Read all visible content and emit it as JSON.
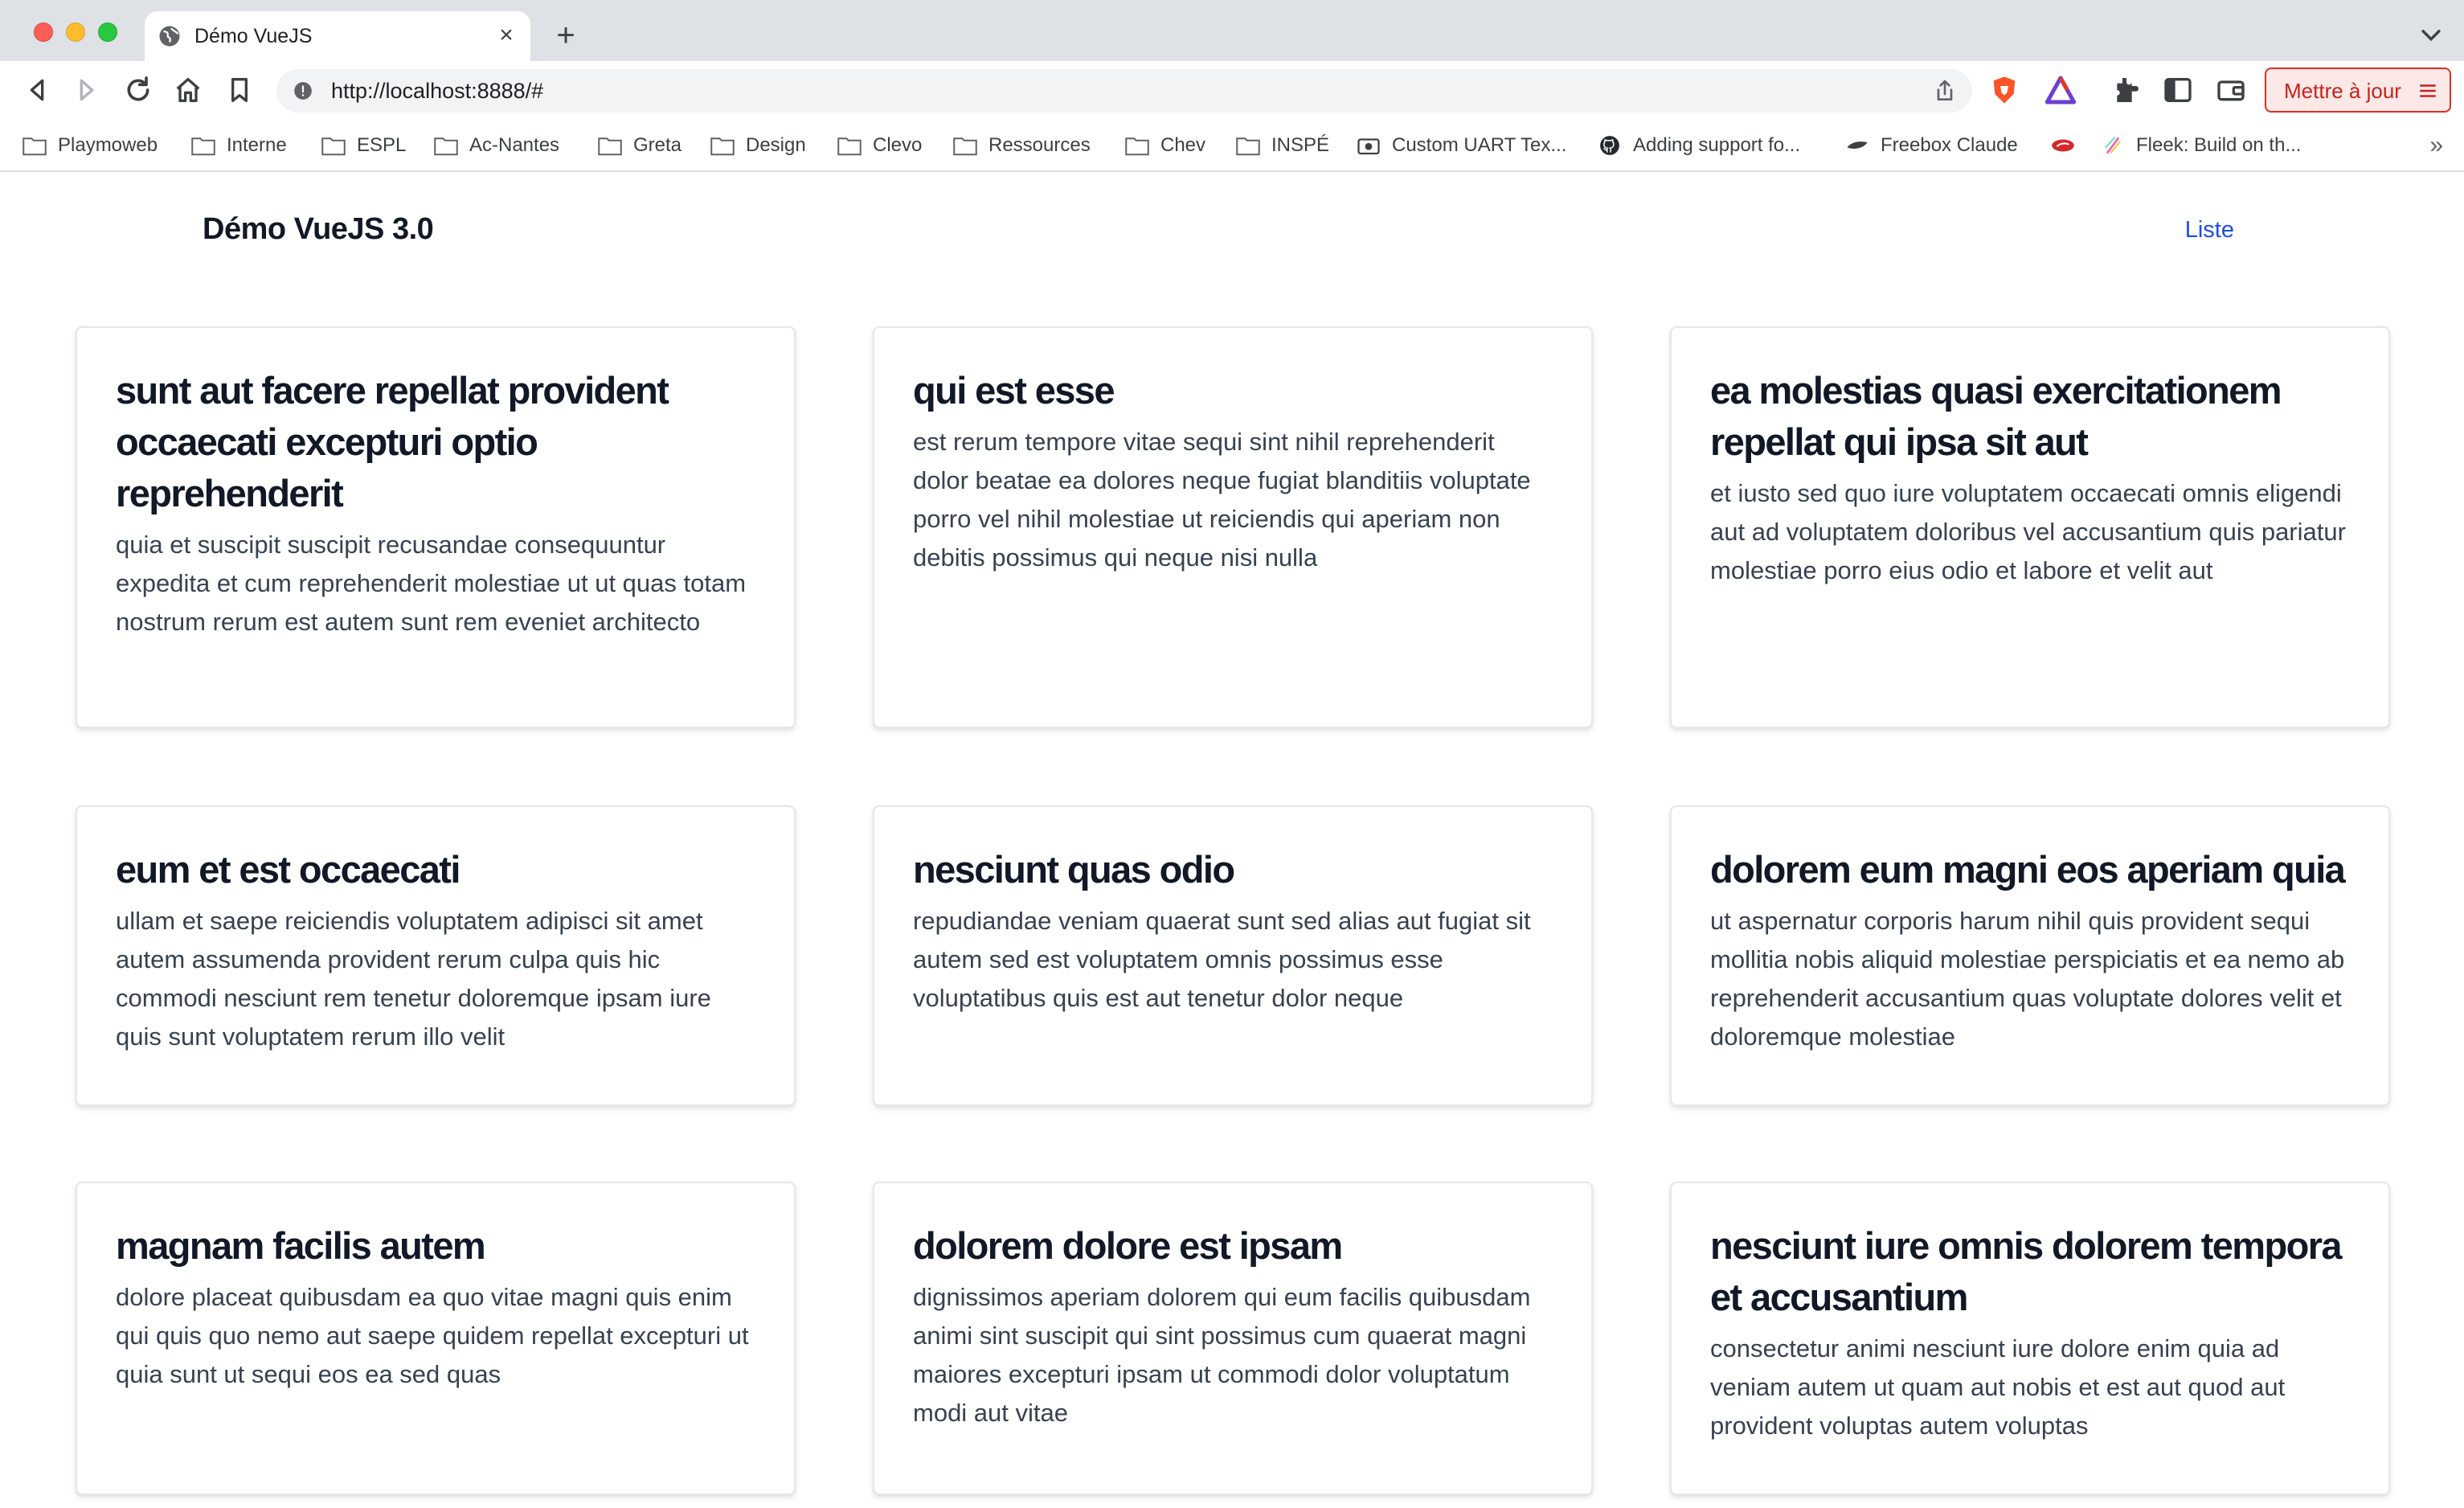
{
  "browser": {
    "tab": {
      "title": "Démo VueJS"
    },
    "address": {
      "url": "http://localhost:8888/#"
    },
    "update_button": {
      "label": "Mettre à jour"
    },
    "bookmarks": [
      {
        "label": "Playmoweb",
        "icon": "folder-icon"
      },
      {
        "label": "Interne",
        "icon": "folder-icon"
      },
      {
        "label": "ESPL",
        "icon": "folder-icon"
      },
      {
        "label": "Ac-Nantes",
        "icon": "folder-icon"
      },
      {
        "label": "Greta",
        "icon": "folder-icon"
      },
      {
        "label": "Design",
        "icon": "folder-icon"
      },
      {
        "label": "Clevo",
        "icon": "folder-icon"
      },
      {
        "label": "Ressources",
        "icon": "folder-icon"
      },
      {
        "label": "Chev",
        "icon": "folder-icon"
      },
      {
        "label": "INSPÉ",
        "icon": "folder-icon"
      },
      {
        "label": "Custom UART Tex...",
        "icon": "camera-icon"
      },
      {
        "label": "Adding support fo...",
        "icon": "github-icon"
      },
      {
        "label": "Freebox Claude",
        "icon": "freebox-icon"
      },
      {
        "label": "",
        "icon": "red-logo-icon"
      },
      {
        "label": "Fleek: Build on th...",
        "icon": "fleek-icon"
      }
    ],
    "more_bookmarks": "»"
  },
  "colors": {
    "link": "#1d4ed8",
    "update_border": "#d93025",
    "update_text": "#c5221f"
  },
  "site": {
    "title": "Démo VueJS 3.0",
    "nav": {
      "list_link": "Liste"
    }
  },
  "posts": [
    {
      "title": "sunt aut facere repellat provident occaecati excepturi optio reprehenderit",
      "body": "quia et suscipit suscipit recusandae consequuntur expedita et cum reprehenderit molestiae ut ut quas totam nostrum rerum est autem sunt rem eveniet architecto"
    },
    {
      "title": "qui est esse",
      "body": "est rerum tempore vitae sequi sint nihil reprehenderit dolor beatae ea dolores neque fugiat blanditiis voluptate porro vel nihil molestiae ut reiciendis qui aperiam non debitis possimus qui neque nisi nulla"
    },
    {
      "title": "ea molestias quasi exercitationem repellat qui ipsa sit aut",
      "body": "et iusto sed quo iure voluptatem occaecati omnis eligendi aut ad voluptatem doloribus vel accusantium quis pariatur molestiae porro eius odio et labore et velit aut"
    },
    {
      "title": "eum et est occaecati",
      "body": "ullam et saepe reiciendis voluptatem adipisci sit amet autem assumenda provident rerum culpa quis hic commodi nesciunt rem tenetur doloremque ipsam iure quis sunt voluptatem rerum illo velit"
    },
    {
      "title": "nesciunt quas odio",
      "body": "repudiandae veniam quaerat sunt sed alias aut fugiat sit autem sed est voluptatem omnis possimus esse voluptatibus quis est aut tenetur dolor neque"
    },
    {
      "title": "dolorem eum magni eos aperiam quia",
      "body": "ut aspernatur corporis harum nihil quis provident sequi mollitia nobis aliquid molestiae perspiciatis et ea nemo ab reprehenderit accusantium quas voluptate dolores velit et doloremque molestiae"
    },
    {
      "title": "magnam facilis autem",
      "body": "dolore placeat quibusdam ea quo vitae magni quis enim qui quis quo nemo aut saepe quidem repellat excepturi ut quia sunt ut sequi eos ea sed quas"
    },
    {
      "title": "dolorem dolore est ipsam",
      "body": "dignissimos aperiam dolorem qui eum facilis quibusdam animi sint suscipit qui sint possimus cum quaerat magni maiores excepturi ipsam ut commodi dolor voluptatum modi aut vitae"
    },
    {
      "title": "nesciunt iure omnis dolorem tempora et accusantium",
      "body": "consectetur animi nesciunt iure dolore enim quia ad veniam autem ut quam aut nobis et est aut quod aut provident voluptas autem voluptas"
    }
  ]
}
